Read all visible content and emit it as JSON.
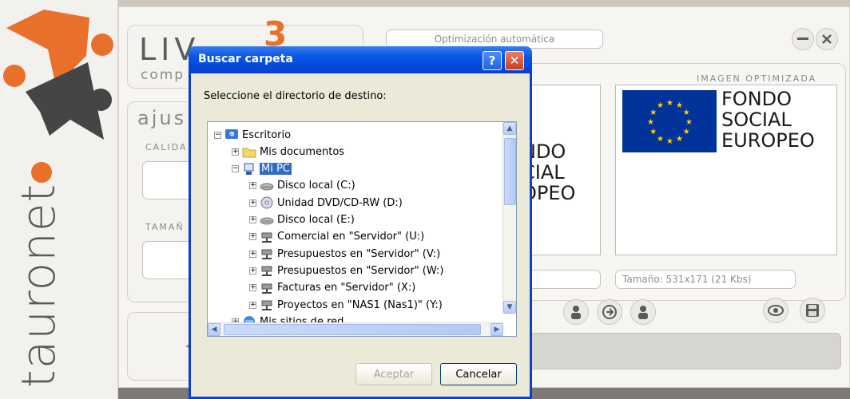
{
  "brand": {
    "name": "tauronet"
  },
  "app": {
    "logo_text": "LIV",
    "logo_sub": "comp",
    "logo_number": "3",
    "mode_field": "Optimización automática",
    "sections": {
      "ajustes": "ajus",
      "calidad": "CALIDA",
      "tamano": "TAMAÑ"
    },
    "optimized_label": "IMAGEN OPTIMIZADA",
    "image_text_lines": [
      "FONDO",
      "SOCIAL",
      "EUROPEO"
    ],
    "original_partial_lines": [
      "NDO",
      "CIAL",
      "OPEO"
    ],
    "size_field": "Tamaño:  531x171  (21 Kbs)",
    "icons": [
      "minimize-icon",
      "close-icon",
      "person-icon",
      "arrow-right-icon",
      "eye-icon",
      "save-icon"
    ]
  },
  "dialog": {
    "title": "Buscar carpeta",
    "help_label": "?",
    "close_label": "✕",
    "instruction": "Seleccione el directorio de destino:",
    "tree": [
      {
        "label": "Escritorio",
        "icon": "desktop-icon",
        "expander": "−"
      },
      {
        "label": "Mis documentos",
        "icon": "folder-icon",
        "expander": "+"
      },
      {
        "label": "Mi PC",
        "icon": "computer-icon",
        "expander": "−",
        "selected": true
      },
      {
        "label": "Disco local (C:)",
        "icon": "drive-icon",
        "expander": "+"
      },
      {
        "label": "Unidad DVD/CD-RW (D:)",
        "icon": "dvd-icon",
        "expander": "+"
      },
      {
        "label": "Disco local (E:)",
        "icon": "drive-icon",
        "expander": "+"
      },
      {
        "label": "Comercial en \"Servidor\" (U:)",
        "icon": "network-drive-icon",
        "expander": "+"
      },
      {
        "label": "Presupuestos en \"Servidor\" (V:)",
        "icon": "network-drive-icon",
        "expander": "+"
      },
      {
        "label": "Presupuestos en \"Servidor\" (W:)",
        "icon": "network-drive-icon",
        "expander": "+"
      },
      {
        "label": "Facturas en \"Servidor\" (X:)",
        "icon": "network-drive-icon",
        "expander": "+"
      },
      {
        "label": "Proyectos en \"NAS1 (Nas1)\" (Y:)",
        "icon": "network-drive-icon",
        "expander": "+"
      },
      {
        "label": "Mis sitios de red",
        "icon": "network-icon",
        "expander": "+"
      }
    ],
    "accept_label": "Aceptar",
    "cancel_label": "Cancelar",
    "accept_enabled": false
  },
  "colors": {
    "titlebar": "#0348d8",
    "selection": "#316ac5",
    "eu_blue": "#003399",
    "eu_gold": "#ffcc00",
    "brand_orange": "#e8702a"
  }
}
